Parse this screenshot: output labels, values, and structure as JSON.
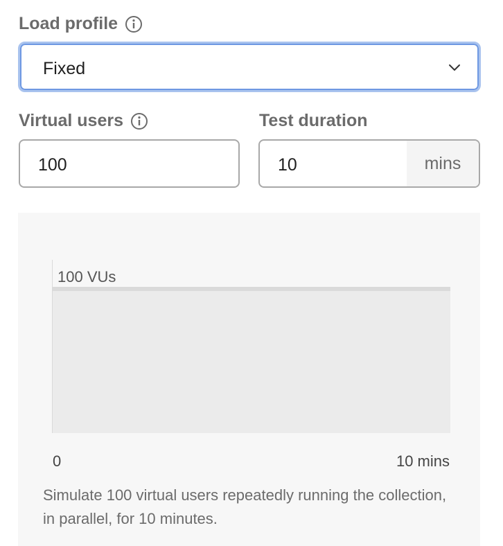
{
  "load_profile": {
    "label": "Load profile",
    "info_icon": "info-icon",
    "selected": "Fixed",
    "dropdown_icon": "chevron-down-icon"
  },
  "virtual_users": {
    "label": "Virtual users",
    "info_icon": "info-icon",
    "value": "100"
  },
  "test_duration": {
    "label": "Test duration",
    "value": "10",
    "unit": "mins"
  },
  "chart": {
    "vu_label": "100 VUs",
    "x_start": "0",
    "x_end": "10 mins",
    "description": "Simulate 100 virtual users repeatedly running the collection, in parallel, for 10 minutes."
  },
  "chart_data": {
    "type": "area",
    "x": [
      0,
      10
    ],
    "values": [
      100,
      100
    ],
    "tick_labels": [
      "0",
      "10 mins"
    ],
    "annotations": [
      "100 VUs"
    ],
    "ylim": [
      0,
      120
    ],
    "grid": false
  },
  "colors": {
    "focus_border": "#6e98e2",
    "panel_bg": "#f7f7f7",
    "area_fill": "#ebebeb"
  }
}
